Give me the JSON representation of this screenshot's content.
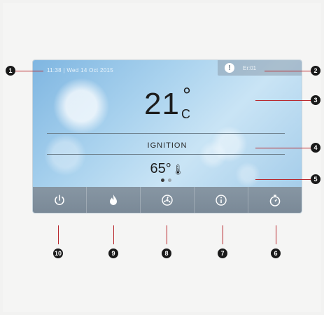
{
  "status": {
    "datetime": "11:38 | Wed 14 Oct 2015"
  },
  "error": {
    "code": "Er:01",
    "icon": "warning-icon"
  },
  "temperature": {
    "value": "21",
    "degree": "°",
    "unit": "C"
  },
  "state": {
    "label": "IGNITION"
  },
  "water": {
    "value": "65°"
  },
  "pager": {
    "pages": 2,
    "active": 1
  },
  "toolbar": {
    "buttons": [
      {
        "name": "power",
        "icon": "power-icon"
      },
      {
        "name": "flame",
        "icon": "flame-icon"
      },
      {
        "name": "fan",
        "icon": "fan-icon"
      },
      {
        "name": "info",
        "icon": "info-icon"
      },
      {
        "name": "timer",
        "icon": "stopwatch-icon"
      }
    ]
  },
  "callouts": [
    "1",
    "2",
    "3",
    "4",
    "5",
    "6",
    "7",
    "8",
    "9",
    "10"
  ],
  "colors": {
    "screen": "#a9d2ee",
    "toolbar": "#7f8e9b",
    "lead": "#b8282d",
    "marker": "#1a1a1a"
  }
}
